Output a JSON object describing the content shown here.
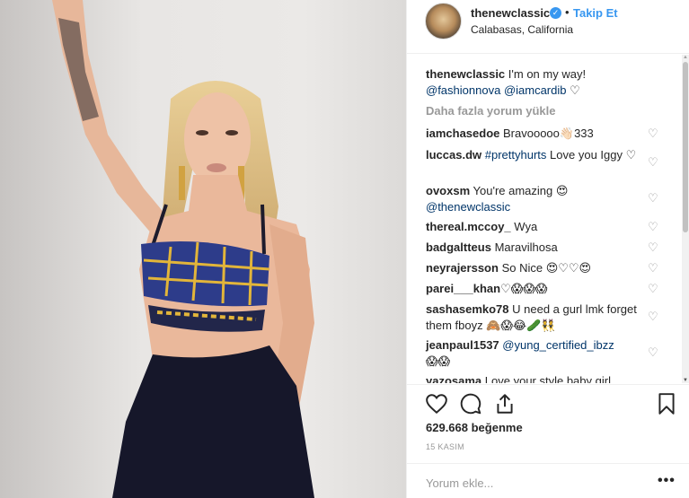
{
  "post": {
    "username": "thenewclassic",
    "verified_icon": "verified-badge-icon",
    "separator": "•",
    "follow_label": "Takip Et",
    "location": "Calabasas, California"
  },
  "caption": {
    "username": "thenewclassic",
    "text": "I'm on my way!",
    "mention1": "@fashionnova",
    "mention2": "@iamcardib",
    "emoji": "♡"
  },
  "load_more": "Daha fazla yorum yükle",
  "comments": [
    {
      "user": "iamchasedoe",
      "text": "Bravooooo👋🏻333"
    },
    {
      "user": "luccas.dw",
      "tag": "#prettyhurts",
      "text": "Love you Iggy ♡"
    },
    {
      "user": "ovoxsm",
      "text": "You're amazing 😍",
      "mention": "@thenewclassic"
    },
    {
      "user": "thereal.mccoy_",
      "text": "Wya"
    },
    {
      "user": "badgaltteus",
      "text": "Maravilhosa"
    },
    {
      "user": "neyrajersson",
      "text": "So Nice 😍♡♡😍"
    },
    {
      "user": "parei___khan",
      "text": "♡😱😱😱"
    },
    {
      "user": "sashasemko78",
      "text": "U need a gurl lmk forget them fboyz 🙈😱😂🥒👯"
    },
    {
      "user": "jeanpaul1537",
      "mention": "@yung_certified_ibzz",
      "text": "😱😱"
    },
    {
      "user": "yazosama",
      "text": "Love your style baby girl"
    }
  ],
  "likes": "629.668 beğenme",
  "date": "15 KASIM",
  "add_comment_placeholder": "Yorum ekle...",
  "more_dots": "•••",
  "colors": {
    "link_blue": "#3897f0",
    "tag_blue": "#003569",
    "muted": "#999999",
    "text": "#262626"
  },
  "icons": [
    "heart-icon",
    "comment-icon",
    "share-icon",
    "bookmark-icon",
    "heart-outline-small-icon",
    "options-icon"
  ]
}
